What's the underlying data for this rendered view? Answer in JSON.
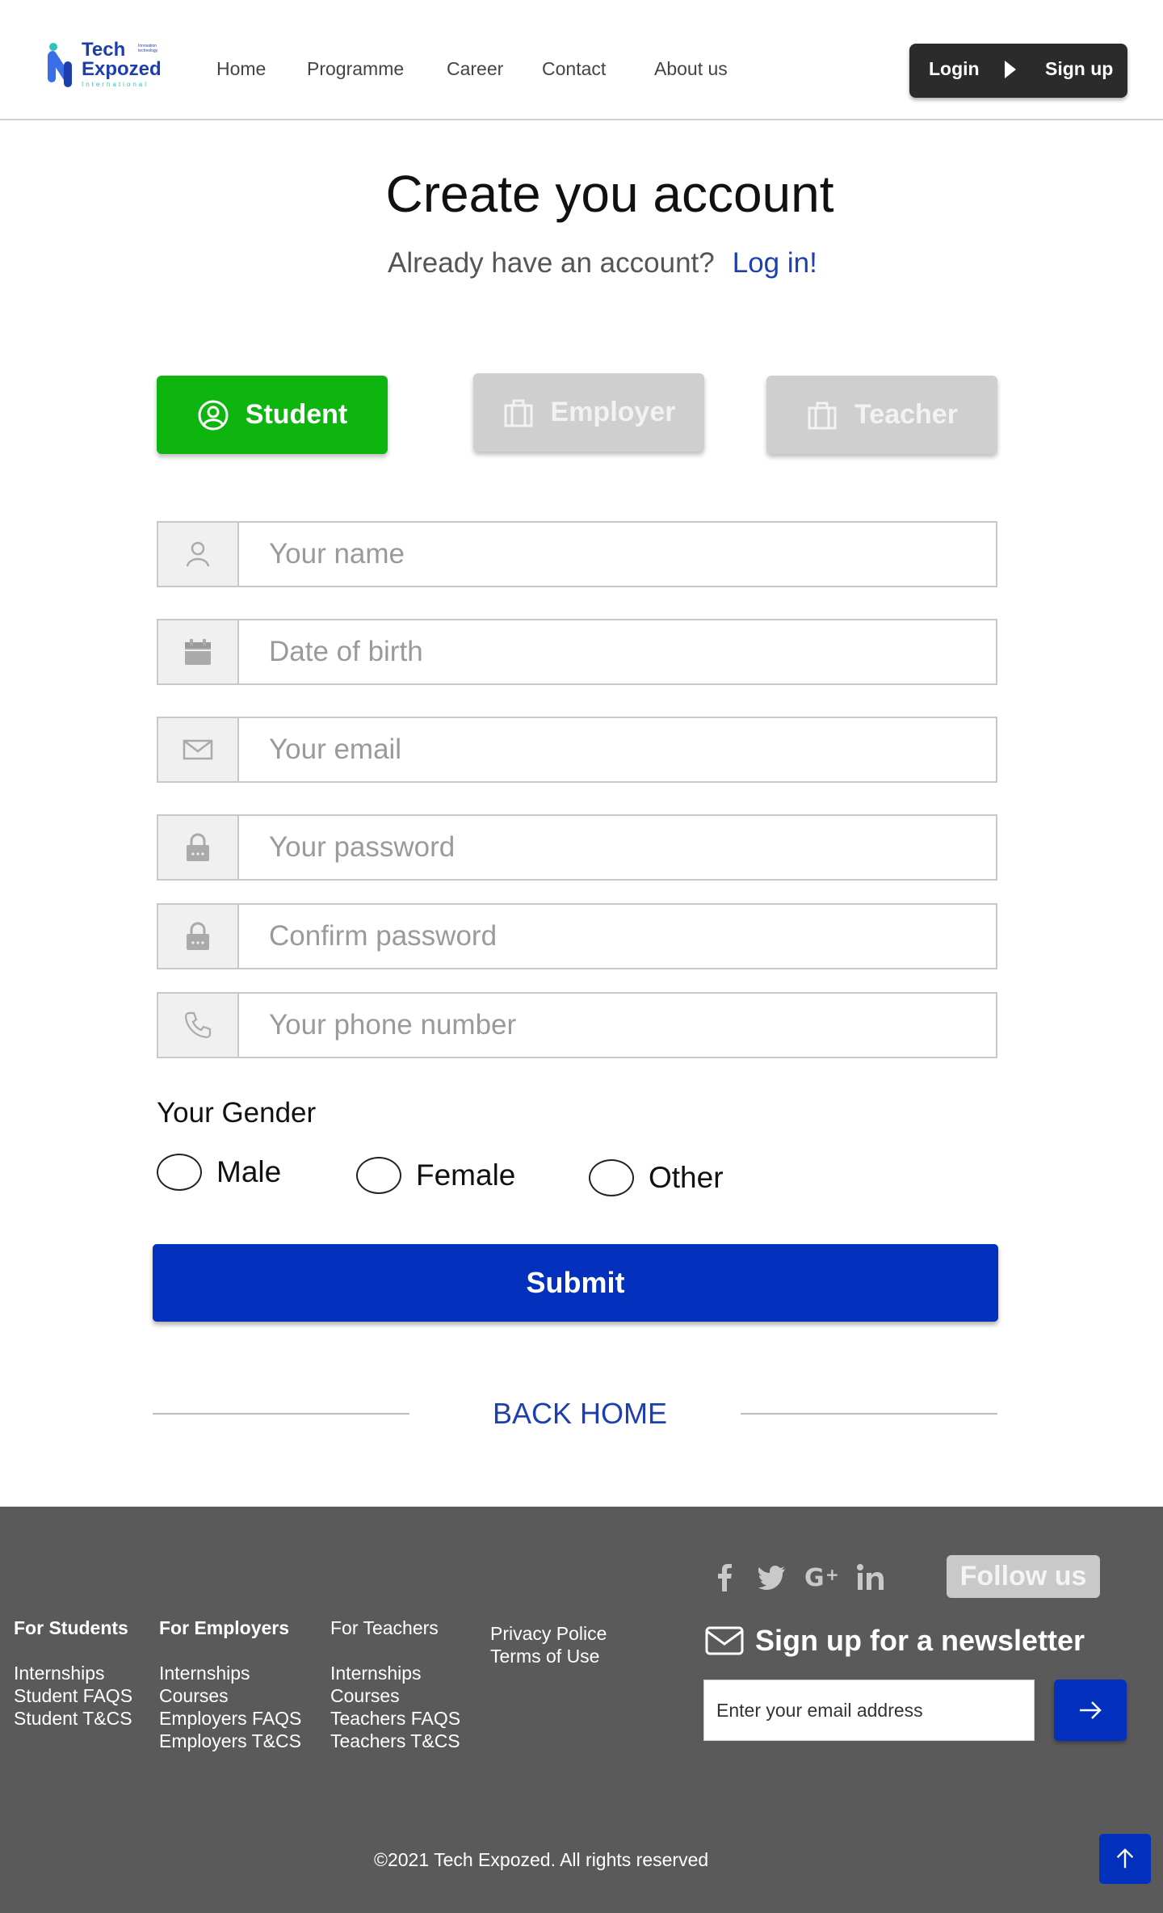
{
  "brand": {
    "name_line1": "Tech",
    "name_line2": "Expozed",
    "tagline": "International",
    "small_text": "Innovation technology"
  },
  "nav": {
    "items": [
      "Home",
      "Programme",
      "Career",
      "Contact",
      "About us"
    ],
    "login_label": "Login",
    "signup_label": "Sign up"
  },
  "page": {
    "title": "Create you account",
    "subtitle": "Already have an account?",
    "login_link": "Log in!"
  },
  "roles": {
    "student": "Student",
    "employer": "Employer",
    "teacher": "Teacher",
    "selected": "Student"
  },
  "form": {
    "name_placeholder": "Your name",
    "dob_placeholder": "Date of birth",
    "email_placeholder": "Your email",
    "password_placeholder": "Your password",
    "confirm_placeholder": "Confirm password",
    "phone_placeholder": "Your phone number",
    "gender_label": "Your Gender",
    "gender_options": [
      "Male",
      "Female",
      "Other"
    ],
    "submit_label": "Submit",
    "back_home": "BACK HOME"
  },
  "footer": {
    "students": {
      "heading": "For Students",
      "links": [
        "Internships",
        "Student FAQS",
        "Student T&CS"
      ]
    },
    "employers": {
      "heading": "For Employers",
      "links": [
        "Internships",
        "Courses",
        "Employers FAQS",
        "Employers T&CS"
      ]
    },
    "teachers": {
      "heading": "For Teachers",
      "links": [
        "Internships",
        "Courses",
        "Teachers FAQS",
        "Teachers T&CS"
      ]
    },
    "legal": [
      "Privacy Police",
      "Terms of Use"
    ],
    "social_icons": [
      "facebook-icon",
      "twitter-icon",
      "google-plus-icon",
      "linkedin-icon"
    ],
    "follow_label": "Follow us",
    "newsletter_label": "Sign up for a newsletter",
    "newsletter_placeholder": "Enter your email address",
    "copyright": "©2021 Tech Expozed. All rights reserved"
  },
  "colors": {
    "primary": "#0331bd",
    "student_green": "#0fb50f",
    "footer_bg": "#5a5a5a",
    "link_blue": "#1e3fb0"
  }
}
